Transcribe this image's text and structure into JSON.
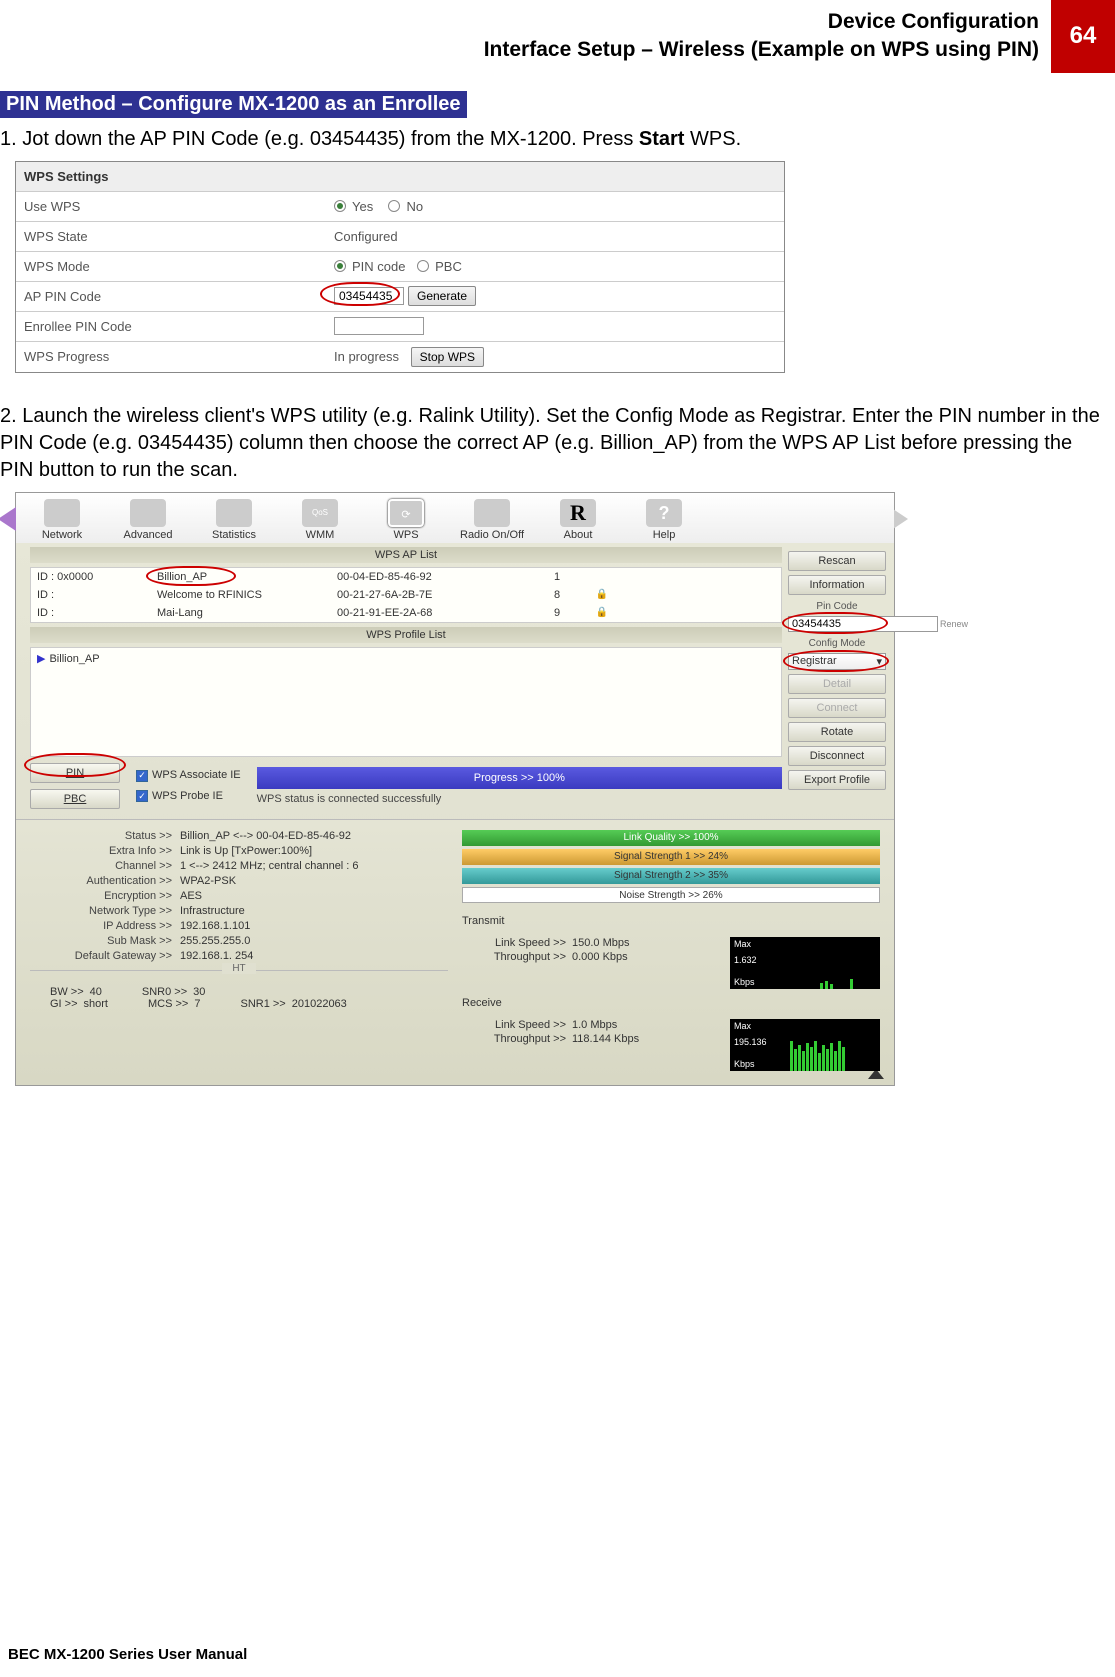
{
  "header": {
    "title_line1": "Device Configuration",
    "title_line2": "Interface Setup – Wireless (Example on WPS using PIN)",
    "page_num": "64"
  },
  "section_title": "PIN Method – Configure MX-1200 as an Enrollee",
  "step1_prefix": "1.  Jot down the AP PIN Code (e.g. 03454435) from the MX-1200. Press ",
  "step1_bold": "Start",
  "step1_suffix": " WPS.",
  "wps": {
    "settings_label": "WPS Settings",
    "use_wps_label": "Use WPS",
    "yes": "Yes",
    "no": "No",
    "state_label": "WPS State",
    "state_value": "Configured",
    "mode_label": "WPS Mode",
    "mode_pin": "PIN code",
    "mode_pbc": "PBC",
    "ap_pin_label": "AP PIN Code",
    "ap_pin_value": "03454435",
    "generate": "Generate",
    "enrollee_label": "Enrollee PIN Code",
    "progress_label": "WPS Progress",
    "progress_value": "In progress",
    "stop_wps": "Stop WPS"
  },
  "step2": "2.  Launch the wireless client's WPS utility (e.g. Ralink Utility). Set the Config Mode as Registrar. Enter the PIN number in the PIN Code (e.g. 03454435) column then choose the correct AP (e.g. Billion_AP) from the WPS AP List before pressing the PIN button to run the scan.",
  "ralink": {
    "nav": {
      "network": "Network",
      "advanced": "Advanced",
      "statistics": "Statistics",
      "wmm": "WMM",
      "wps": "WPS",
      "radio": "Radio On/Off",
      "about": "About",
      "help": "Help"
    },
    "ap_list_title": "WPS AP List",
    "ap_rows": [
      {
        "id": "ID : 0x0000",
        "name": "Billion_AP",
        "mac": "00-04-ED-85-46-92",
        "ch": "1",
        "lock": ""
      },
      {
        "id": "ID :",
        "name": "Welcome to RFINICS",
        "mac": "00-21-27-6A-2B-7E",
        "ch": "8",
        "lock": "🔒"
      },
      {
        "id": "ID :",
        "name": "Mai-Lang",
        "mac": "00-21-91-EE-2A-68",
        "ch": "9",
        "lock": "🔒"
      }
    ],
    "profile_title": "WPS Profile List",
    "profile_item": "Billion_AP",
    "side": {
      "rescan": "Rescan",
      "information": "Information",
      "pin_code_label": "Pin Code",
      "pin_code_value": "03454435",
      "renew": "Renew",
      "config_mode_label": "Config Mode",
      "config_mode_value": "Registrar",
      "detail": "Detail",
      "connect": "Connect",
      "rotate": "Rotate",
      "disconnect": "Disconnect",
      "export": "Export Profile"
    },
    "pin_btn": "PIN",
    "pbc_btn": "PBC",
    "chk1": "WPS Associate IE",
    "chk2": "WPS Probe IE",
    "progress_text": "Progress >> 100%",
    "status_text": "WPS status is connected successfully",
    "signals": {
      "link_quality": "Link Quality >> 100%",
      "sig1": "Signal Strength 1 >> 24%",
      "sig2": "Signal Strength 2 >> 35%",
      "noise": "Noise Strength >> 26%"
    },
    "status_kv": [
      {
        "k": "Status >>",
        "v": "Billion_AP  <--> 00-04-ED-85-46-92"
      },
      {
        "k": "Extra Info >>",
        "v": "Link is Up [TxPower:100%]"
      },
      {
        "k": "Channel >>",
        "v": "1 <--> 2412 MHz; central channel : 6"
      },
      {
        "k": "Authentication >>",
        "v": "WPA2-PSK"
      },
      {
        "k": "Encryption >>",
        "v": "AES"
      },
      {
        "k": "Network Type >>",
        "v": "Infrastructure"
      },
      {
        "k": "IP Address >>",
        "v": "192.168.1.101"
      },
      {
        "k": "Sub Mask >>",
        "v": "255.255.255.0"
      },
      {
        "k": "Default Gateway >>",
        "v": "192.168.1. 254"
      }
    ],
    "transmit_label": "Transmit",
    "receive_label": "Receive",
    "tx": {
      "speed_k": "Link Speed >>",
      "speed_v": "150.0 Mbps",
      "thr_k": "Throughput >>",
      "thr_v": "0.000 Kbps",
      "max": "Max",
      "maxv": "1.632",
      "unit": "Kbps"
    },
    "rx": {
      "speed_k": "Link Speed >>",
      "speed_v": "1.0 Mbps",
      "thr_k": "Throughput >>",
      "thr_v": "118.144 Kbps",
      "max": "Max",
      "maxv": "195.136",
      "unit": "Kbps"
    },
    "ht_label": "HT",
    "ht": {
      "bw_k": "BW >>",
      "bw_v": "40",
      "gi_k": "GI >>",
      "gi_v": "short",
      "mcs_k": "MCS >>",
      "mcs_v": "7",
      "snr0_k": "SNR0 >>",
      "snr0_v": "30",
      "snr1_k": "SNR1 >>",
      "snr1_v": "201022063"
    }
  },
  "footer": "BEC MX-1200 Series User Manual"
}
